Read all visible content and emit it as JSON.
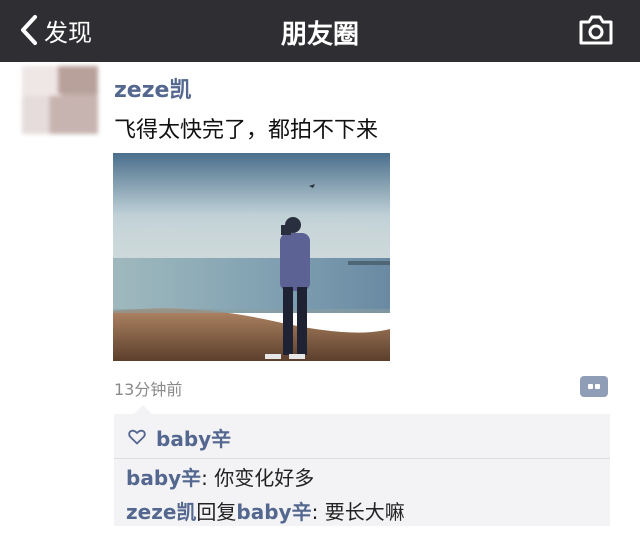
{
  "navbar": {
    "back_label": "发现",
    "title": "朋友圈"
  },
  "post": {
    "author": "zeze凯",
    "text": "飞得太快完了，都拍不下来",
    "time": "13分钟前"
  },
  "likes": {
    "users": [
      "baby辛"
    ]
  },
  "comments": [
    {
      "author": "baby辛",
      "separator": ": ",
      "text": "你变化好多"
    },
    {
      "author": "zeze凯",
      "reply_word": "回复",
      "reply_to": "baby辛",
      "separator": ": ",
      "text": "要长大嘛"
    }
  ],
  "colors": {
    "navbar_bg": "#2f2f33",
    "link": "#54678f",
    "comment_bg": "#f3f3f5"
  }
}
